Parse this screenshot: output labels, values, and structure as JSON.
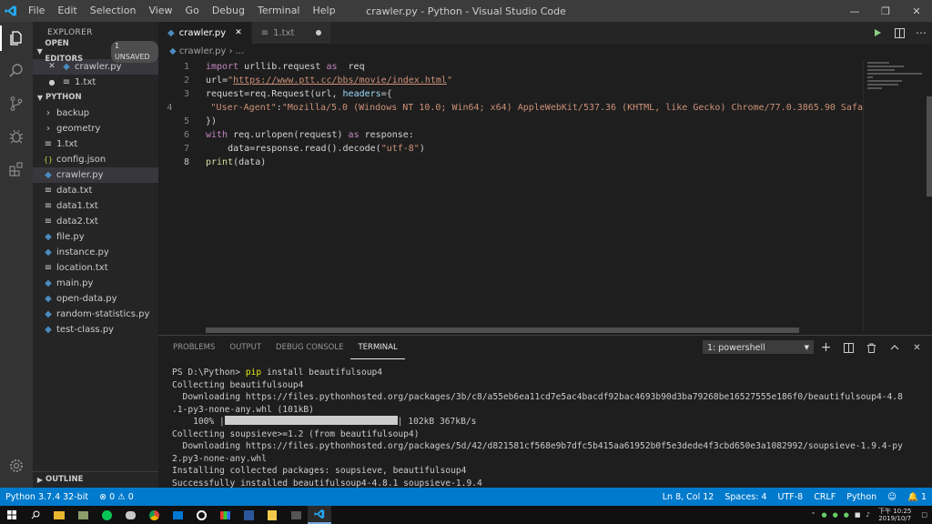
{
  "window": {
    "title": "crawler.py - Python - Visual Studio Code",
    "menu": [
      "File",
      "Edit",
      "Selection",
      "View",
      "Go",
      "Debug",
      "Terminal",
      "Help"
    ]
  },
  "sidebar": {
    "header": "EXPLORER",
    "open_editors": {
      "label": "OPEN EDITORS",
      "badge": "1 UNSAVED",
      "files": [
        "crawler.py",
        "1.txt"
      ]
    },
    "folder": {
      "label": "PYTHON",
      "items": [
        {
          "name": "backup",
          "type": "folder"
        },
        {
          "name": "geometry",
          "type": "folder"
        },
        {
          "name": "1.txt",
          "type": "txt"
        },
        {
          "name": "config.json",
          "type": "json"
        },
        {
          "name": "crawler.py",
          "type": "py"
        },
        {
          "name": "data.txt",
          "type": "txt"
        },
        {
          "name": "data1.txt",
          "type": "txt"
        },
        {
          "name": "data2.txt",
          "type": "txt"
        },
        {
          "name": "file.py",
          "type": "py"
        },
        {
          "name": "instance.py",
          "type": "py"
        },
        {
          "name": "location.txt",
          "type": "txt"
        },
        {
          "name": "main.py",
          "type": "py"
        },
        {
          "name": "open-data.py",
          "type": "py"
        },
        {
          "name": "random-statistics.py",
          "type": "py"
        },
        {
          "name": "test-class.py",
          "type": "py"
        }
      ]
    },
    "outline": "OUTLINE"
  },
  "tabs": [
    {
      "label": "crawler.py",
      "active": true
    },
    {
      "label": "1.txt",
      "active": false
    }
  ],
  "breadcrumb": {
    "file": "crawler.py",
    "rest": "..."
  },
  "code": {
    "line_numbers": [
      "1",
      "2",
      "3",
      "4",
      "5",
      "6",
      "7",
      "8"
    ],
    "l1": {
      "kw1": "import",
      "mod": " urllib.request ",
      "kw2": "as",
      "alias": "  req"
    },
    "l2": {
      "var": "url",
      "eq": "=",
      "q1": "\"",
      "url": "https://www.ptt.cc/bbs/movie/index.html",
      "q2": "\""
    },
    "l3": {
      "var": "request",
      "eq": "=req.Request(url, ",
      "param": "headers",
      "brace": "={"
    },
    "l4": {
      "indent": "    ",
      "key": "\"User-Agent\"",
      "colon": ":",
      "val": "\"Mozilla/5.0 (Windows NT 10.0; Win64; x64) AppleWebKit/537.36 (KHTML, like Gecko) Chrome/77.0.3865.90 Safa"
    },
    "l5": {
      "text": "})"
    },
    "l6": {
      "kw1": "with",
      "mid": " req.urlopen(request) ",
      "kw2": "as",
      "var": " response",
      "colon": ":"
    },
    "l7": {
      "indent": "    ",
      "var": "data",
      "mid": "=response.read().decode(",
      "str": "\"utf-8\"",
      "end": ")"
    },
    "l8": {
      "fn": "print",
      "mid": "(data)"
    }
  },
  "panel": {
    "tabs": [
      "PROBLEMS",
      "OUTPUT",
      "DEBUG CONSOLE",
      "TERMINAL"
    ],
    "active_tab": "TERMINAL",
    "terminal_select": "1: powershell",
    "lines": {
      "t1_prompt": "PS D:\\Python> ",
      "t1_cmd": "pip",
      "t1_args": " install beautifulsoup4",
      "t2": "Collecting beautifulsoup4",
      "t3": "  Downloading https://files.pythonhosted.org/packages/3b/c8/a55eb6ea11cd7e5ac4bacdf92bac4693b90d3ba79268be16527555e186f0/beautifulsoup4-4.8",
      "t4": ".1-py3-none-any.whl (101kB)",
      "t5_pct": "    100% |",
      "t5_end": "| 102kB 367kB/s",
      "t6": "Collecting soupsieve>=1.2 (from beautifulsoup4)",
      "t7": "  Downloading https://files.pythonhosted.org/packages/5d/42/d821581cf568e9b7dfc5b415aa61952b0f5e3dede4f3cbd650e3a1082992/soupsieve-1.9.4-py",
      "t8": "2.py3-none-any.whl",
      "t9": "Installing collected packages: soupsieve, beautifulsoup4",
      "t10": "Successfully installed beautifulsoup4-4.8.1 soupsieve-1.9.4"
    },
    "progress": 1.0
  },
  "status": {
    "interpreter": "Python 3.7.4 32-bit",
    "errors": "0",
    "warnings": "0",
    "position": "Ln 8, Col 12",
    "spaces": "Spaces: 4",
    "encoding": "UTF-8",
    "eol": "CRLF",
    "language": "Python",
    "notifications": "1"
  },
  "taskbar": {
    "clock_time": "下午 10:25",
    "clock_date": "2019/10/7"
  },
  "colors": {
    "accent": "#007acc",
    "activity": "#333333",
    "sidebar": "#252526",
    "editor": "#1e1e1e"
  }
}
